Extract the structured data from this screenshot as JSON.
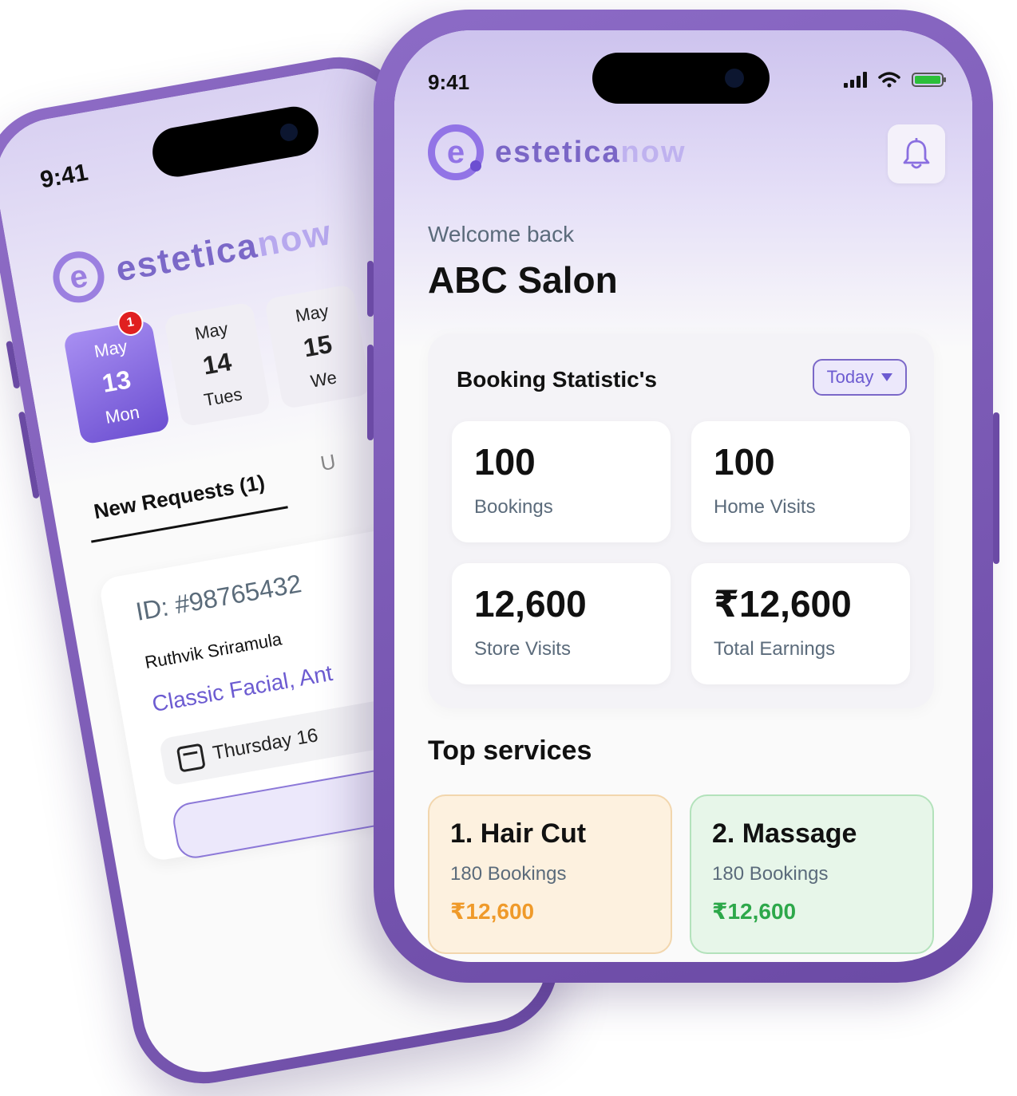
{
  "back_phone": {
    "time": "9:41",
    "logo": {
      "word_main": "estetica",
      "word_accent": "now"
    },
    "dates": [
      {
        "month": "May",
        "day": "13",
        "weekday": "Mon",
        "badge": "1",
        "active": true
      },
      {
        "month": "May",
        "day": "14",
        "weekday": "Tues"
      },
      {
        "month": "May",
        "day": "15",
        "weekday": "We"
      }
    ],
    "tabs": {
      "new_requests": "New Requests (1)",
      "upcoming": "U"
    },
    "request": {
      "id": "ID: #98765432",
      "customer": "Ruthvik Sriramula",
      "services": "Classic Facial, Ant",
      "date": "Thursday 16"
    }
  },
  "front_phone": {
    "time": "9:41",
    "logo": {
      "word_main": "estetica",
      "word_accent": "now"
    },
    "welcome": "Welcome back",
    "salon_name": "ABC Salon",
    "stats": {
      "title": "Booking Statistic's",
      "filter": "Today",
      "tiles": [
        {
          "value": "100",
          "label": "Bookings"
        },
        {
          "value": "100",
          "label": "Home Visits"
        },
        {
          "value": "12,600",
          "label": "Store Visits"
        },
        {
          "value": "₹12,600",
          "label": "Total Earnings"
        }
      ]
    },
    "top_services": {
      "title": "Top services",
      "items": [
        {
          "name": "1. Hair Cut",
          "bookings": "180 Bookings",
          "earnings": "₹12,600"
        },
        {
          "name": "2. Massage",
          "bookings": "180 Bookings",
          "earnings": "₹12,600"
        }
      ]
    }
  },
  "colors": {
    "brand_purple": "#6c4fd1",
    "phone_frame": "#7a5ab5",
    "accent_orange": "#ef9a2a",
    "accent_green": "#2da84a"
  }
}
